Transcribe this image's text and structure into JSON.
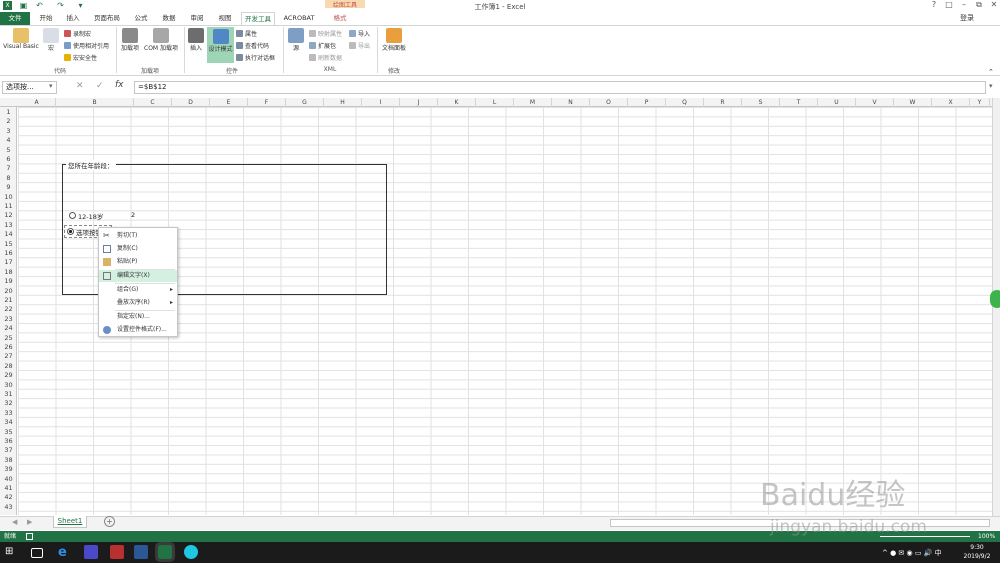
{
  "window": {
    "title": "工作簿1 - Excel",
    "context_tab_group": "绘图工具",
    "login": "登录"
  },
  "tabs": [
    "文件",
    "开始",
    "插入",
    "页面布局",
    "公式",
    "数据",
    "审阅",
    "视图",
    "开发工具",
    "ACROBAT",
    "格式"
  ],
  "ribbon": {
    "code": {
      "visual_basic": "Visual Basic",
      "macro": "宏",
      "record_macro": "录制宏",
      "relative_ref": "使用相对引用",
      "macro_security": "宏安全性",
      "label": "代码"
    },
    "addins": {
      "addins": "加载项",
      "com_addins": "COM 加载项",
      "label": "加载项"
    },
    "controls": {
      "insert": "插入",
      "design_mode": "设计模式",
      "properties": "属性",
      "view_code": "查看代码",
      "run_dialog": "执行对话框",
      "label": "控件"
    },
    "xml": {
      "source": "源",
      "map_props": "映射属性",
      "expansion_packs": "扩展包",
      "refresh_data": "刷新数据",
      "import": "导入",
      "export": "导出",
      "label": "XML"
    },
    "modify": {
      "doc_panel": "文档面板",
      "label": "修改"
    }
  },
  "formula_bar": {
    "name_box": "选项按...",
    "formula": "=$B$12"
  },
  "columns": [
    "A",
    "B",
    "C",
    "D",
    "E",
    "F",
    "G",
    "H",
    "I",
    "J",
    "K",
    "L",
    "M",
    "N",
    "O",
    "P",
    "Q",
    "R",
    "S",
    "T",
    "U",
    "V",
    "W",
    "X",
    "Y"
  ],
  "rows": [
    "1",
    "2",
    "3",
    "4",
    "5",
    "6",
    "7",
    "8",
    "9",
    "10",
    "11",
    "12",
    "13",
    "14",
    "15",
    "16",
    "17",
    "18",
    "19",
    "20",
    "21",
    "22",
    "23",
    "24",
    "25",
    "26",
    "27",
    "28",
    "29",
    "30",
    "31",
    "32",
    "33",
    "34",
    "35",
    "36",
    "37",
    "38",
    "39",
    "40",
    "41",
    "42",
    "43"
  ],
  "form": {
    "group_label": "您所在年龄段：",
    "option1": "12-18岁",
    "option2": "选项按钮",
    "linked_value": "2"
  },
  "context_menu": [
    {
      "label": "剪切(T)",
      "icon": "scissors-icon"
    },
    {
      "label": "复制(C)",
      "icon": "copy-icon"
    },
    {
      "label": "粘贴(P)",
      "icon": "paste-icon"
    },
    {
      "label": "编辑文字(X)",
      "icon": "edit-text-icon"
    },
    {
      "label": "组合(G)",
      "icon": ""
    },
    {
      "label": "叠放次序(R)",
      "icon": ""
    },
    {
      "label": "指定宏(N)...",
      "icon": ""
    },
    {
      "label": "设置控件格式(F)...",
      "icon": "format-control-icon"
    }
  ],
  "sheet": {
    "tab": "Sheet1"
  },
  "status": {
    "ready": "就绪",
    "zoom": "100%"
  },
  "clock": {
    "time": "9:30",
    "date": "2019/9/2"
  },
  "watermark": "Baidu经验",
  "watermark_url": "jingyan.baidu.com",
  "colors": {
    "excel_green": "#217346",
    "highlight": "#d3f0e0"
  }
}
